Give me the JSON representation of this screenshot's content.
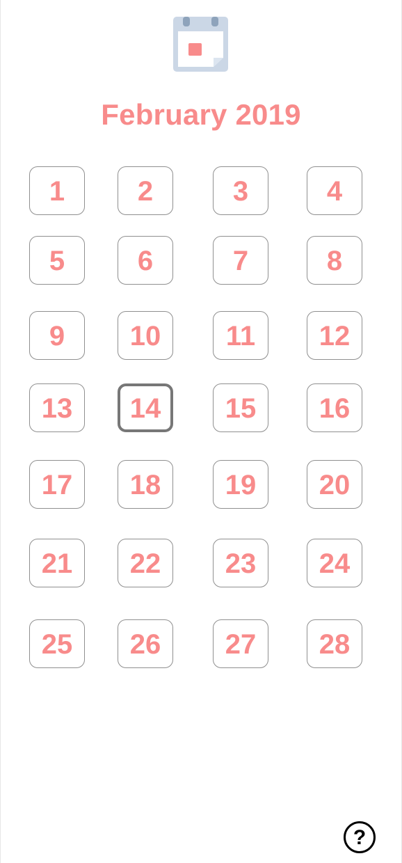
{
  "header": {
    "title": "February 2019",
    "logo_icon": "calendar-icon"
  },
  "days": [
    {
      "label": "1"
    },
    {
      "label": "2"
    },
    {
      "label": "3"
    },
    {
      "label": "4"
    },
    {
      "label": "5"
    },
    {
      "label": "6"
    },
    {
      "label": "7"
    },
    {
      "label": "8"
    },
    {
      "label": "9"
    },
    {
      "label": "10"
    },
    {
      "label": "11"
    },
    {
      "label": "12"
    },
    {
      "label": "13"
    },
    {
      "label": "14",
      "selected": true
    },
    {
      "label": "15"
    },
    {
      "label": "16"
    },
    {
      "label": "17"
    },
    {
      "label": "18"
    },
    {
      "label": "19"
    },
    {
      "label": "20"
    },
    {
      "label": "21"
    },
    {
      "label": "22"
    },
    {
      "label": "23"
    },
    {
      "label": "24"
    },
    {
      "label": "25"
    },
    {
      "label": "26"
    },
    {
      "label": "27"
    },
    {
      "label": "28"
    }
  ],
  "help": {
    "label": "?",
    "icon": "help-icon"
  },
  "colors": {
    "accent": "#f88b8b",
    "border": "#8f8f8f",
    "selected_border": "#777777",
    "logo": "#cbd7e6"
  }
}
